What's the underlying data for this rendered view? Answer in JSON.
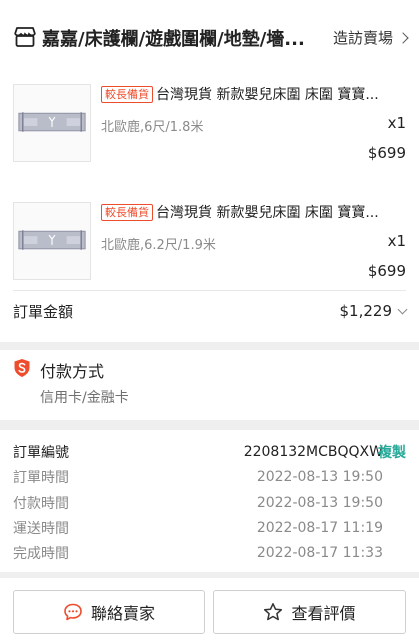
{
  "shop": {
    "name": "嘉嘉/床護欄/遊戲圍欄/地墊/墻...",
    "visit_label": "造訪賣場",
    "icon": "shop-icon"
  },
  "items": [
    {
      "tag": "較長備貨",
      "title": "台灣現貨 新款嬰兒床圍 床圍 寶寶...",
      "variant": "北歐鹿,6尺/1.8米",
      "qty": "x1",
      "price": "$699"
    },
    {
      "tag": "較長備貨",
      "title": "台灣現貨 新款嬰兒床圍 床圍 寶寶...",
      "variant": "北歐鹿,6.2尺/1.9米",
      "qty": "x1",
      "price": "$699"
    }
  ],
  "total": {
    "label": "訂單金額",
    "value": "$1,229"
  },
  "payment": {
    "title": "付款方式",
    "method": "信用卡/金融卡",
    "icon": "payment-shield-icon"
  },
  "order_info": {
    "order_no_label": "訂單編號",
    "order_no": "2208132MCBQQXW",
    "copy_label": "複製",
    "rows": [
      {
        "label": "訂單時間",
        "value": "2022-08-13 19:50"
      },
      {
        "label": "付款時間",
        "value": "2022-08-13 19:50"
      },
      {
        "label": "運送時間",
        "value": "2022-08-17 11:19"
      },
      {
        "label": "完成時間",
        "value": "2022-08-17 11:33"
      }
    ]
  },
  "actions": {
    "chat_label": "聯絡賣家",
    "rate_label": "查看評價"
  },
  "colors": {
    "brand": "#ee4d2d",
    "copy": "#26aa99"
  }
}
